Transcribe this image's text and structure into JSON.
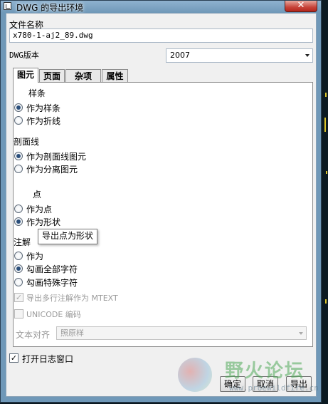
{
  "window": {
    "title": "DWG 的导出环境",
    "close_symbol": "✕"
  },
  "file_name": {
    "label": "文件名称",
    "value": "x780-1-aj2_89.dwg"
  },
  "dwg_version": {
    "label": "DWG版本",
    "value": "2007"
  },
  "tabs": [
    {
      "label": "图元",
      "active": true
    },
    {
      "label": "页面",
      "active": false
    },
    {
      "label": "杂项",
      "active": false
    },
    {
      "label": "属性",
      "active": false
    }
  ],
  "spline": {
    "heading": "样条",
    "options": [
      {
        "label": "作为样条",
        "checked": true
      },
      {
        "label": "作为折线",
        "checked": false
      }
    ]
  },
  "hatch": {
    "heading": "剖面线",
    "options": [
      {
        "label": "作为剖面线图元",
        "checked": true
      },
      {
        "label": "作为分离图元",
        "checked": false
      }
    ]
  },
  "point": {
    "heading": "点",
    "options": [
      {
        "label": "作为点",
        "checked": false
      },
      {
        "label": "作为形状",
        "checked": true
      }
    ]
  },
  "annotation": {
    "heading": "注解",
    "options": [
      {
        "label": "作为",
        "checked": false
      },
      {
        "label": "勾画全部字符",
        "checked": true
      },
      {
        "label": "勾画特殊字符",
        "checked": false
      }
    ],
    "mtext_label": "导出多行注解作为 MTEXT",
    "unicode_label": "UNICODE 编码",
    "text_align_label": "文本对齐",
    "text_align_value": "照原样"
  },
  "tooltip": "导出点为形状",
  "open_log": {
    "label": "打开日志窗口",
    "checked": true
  },
  "buttons": {
    "ok": "确定",
    "cancel": "取消",
    "export": "导出"
  },
  "watermark": {
    "text": "野火论坛",
    "url": "www.proewildfire.cn"
  },
  "colors": {
    "title_bar": "#6f98b8",
    "close_button": "#c7443a",
    "radio_dot": "#2a4e7a"
  }
}
